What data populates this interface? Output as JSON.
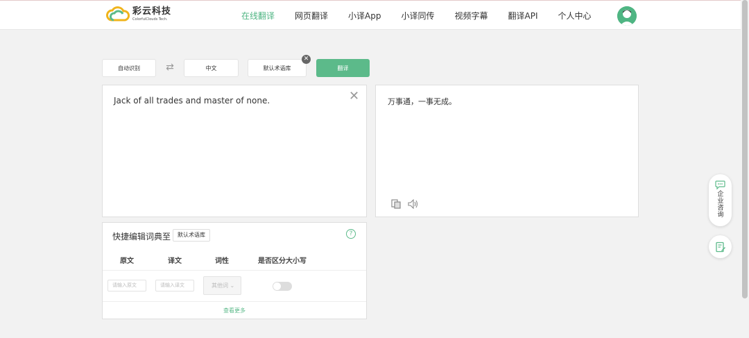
{
  "header": {
    "logo_name": "彩云科技",
    "logo_en": "ColorfulClouds Tech.",
    "nav": [
      {
        "label": "在线翻译",
        "active": true
      },
      {
        "label": "网页翻译"
      },
      {
        "label": "小译App"
      },
      {
        "label": "小译同传"
      },
      {
        "label": "视频字幕"
      },
      {
        "label": "翻译API"
      },
      {
        "label": "个人中心"
      }
    ]
  },
  "toolbar": {
    "source_lang": "自动识别",
    "target_lang": "中文",
    "glossary": "默认术语库",
    "translate_label": "翻译",
    "remove_icon": "close-icon",
    "swap_icon": "swap-icon"
  },
  "source": {
    "text": "Jack of all trades and master of none."
  },
  "target": {
    "text": "万事通，一事无成。"
  },
  "dictionary": {
    "title": "快捷编辑词典至",
    "glossary_tag": "默认术语库",
    "columns": [
      "原文",
      "译文",
      "词性",
      "是否区分大小写"
    ],
    "source_placeholder": "请输入原文",
    "target_placeholder": "请输入译文",
    "pos_value": "其他词",
    "case_sensitive": false,
    "view_more": "查看更多"
  },
  "float": {
    "consult_label": "企业咨询"
  },
  "colors": {
    "accent": "#5cba8a",
    "active_nav": "#4fb583"
  }
}
